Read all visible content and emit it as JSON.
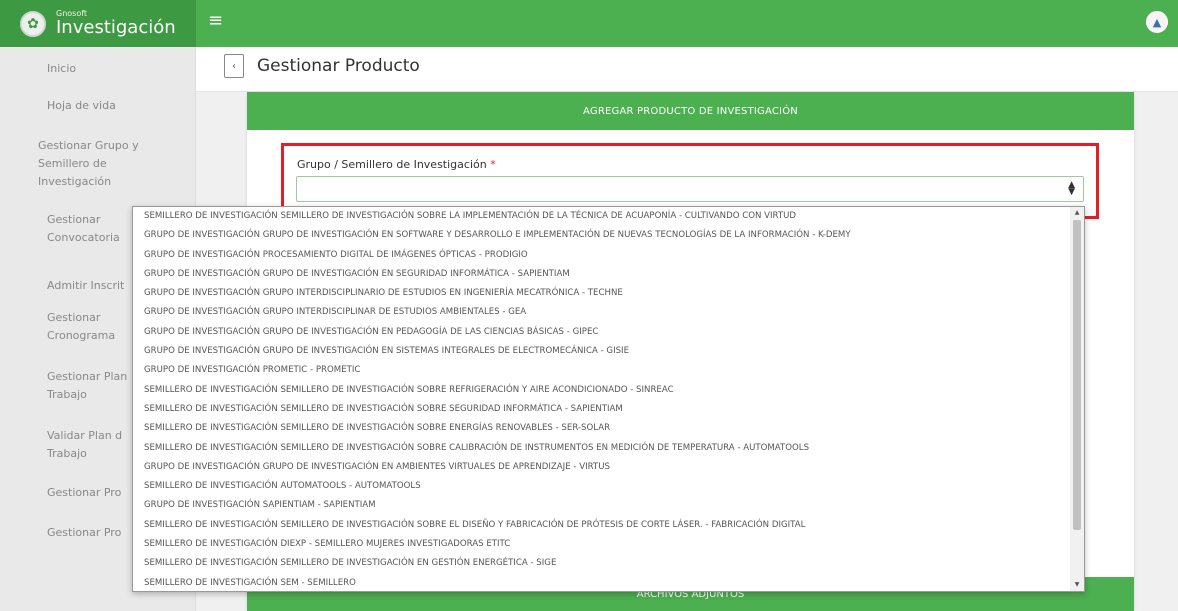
{
  "brand": {
    "small": "Gnosoft",
    "name": "Investigación"
  },
  "icons": {
    "hamburger": "≡",
    "avatar": "user-avatar-icon",
    "back": "‹",
    "select_arrow": "⇕"
  },
  "sidebar": {
    "items": [
      {
        "label": "Inicio"
      },
      {
        "label": "Hoja de vida"
      },
      {
        "label": "Gestionar Grupo y Semillero de Investigación"
      },
      {
        "label": "Gestionar Convocatoria"
      },
      {
        "label": "Admitir Inscrit"
      },
      {
        "label": "Gestionar Cronograma"
      },
      {
        "label": "Gestionar Plan Trabajo"
      },
      {
        "label": "Validar Plan d Trabajo"
      },
      {
        "label": "Gestionar Pro"
      },
      {
        "label": "Gestionar Pro"
      }
    ]
  },
  "page": {
    "title": "Gestionar Producto"
  },
  "card": {
    "header": "AGREGAR PRODUCTO DE INVESTIGACIÓN",
    "field_label": "Grupo / Semillero de Investigación",
    "required_mark": "*",
    "selected_value": ""
  },
  "bottom_bar": {
    "label": "ARCHIVOS ADJUNTOS"
  },
  "dropdown": {
    "options": [
      "SEMILLERO DE INVESTIGACIÓN SEMILLERO DE INVESTIGACIÓN SOBRE LA IMPLEMENTACIÓN DE LA TÉCNICA DE ACUAPONÍA - CULTIVANDO CON VIRTUD",
      "GRUPO DE INVESTIGACIÓN GRUPO DE INVESTIGACIÓN EN SOFTWARE Y DESARROLLO E IMPLEMENTACIÓN DE NUEVAS TECNOLOGÍAS DE LA INFORMACIÓN - K-DEMY",
      "GRUPO DE INVESTIGACIÓN PROCESAMIENTO DIGITAL DE IMÁGENES ÓPTICAS - PRODIGIO",
      "GRUPO DE INVESTIGACIÓN GRUPO DE INVESTIGACIÓN EN SEGURIDAD INFORMÁTICA - SAPIENTIAM",
      "GRUPO DE INVESTIGACIÓN GRUPO INTERDISCIPLINARIO DE ESTUDIOS EN INGENIERÍA MECATRÓNICA - TECHNE",
      "GRUPO DE INVESTIGACIÓN GRUPO INTERDISCIPLINAR DE ESTUDIOS AMBIENTALES - GEA",
      "GRUPO DE INVESTIGACIÓN GRUPO DE INVESTIGACIÓN EN PEDAGOGÍA DE LAS CIENCIAS BÁSICAS - GIPEC",
      "GRUPO DE INVESTIGACIÓN GRUPO DE INVESTIGACIÓN EN SISTEMAS INTEGRALES DE ELECTROMECÁNICA - GISIE",
      "GRUPO DE INVESTIGACIÓN PROMETIC - PROMETIC",
      "SEMILLERO DE INVESTIGACIÓN SEMILLERO DE INVESTIGACIÓN SOBRE REFRIGERACIÓN Y AIRE ACONDICIONADO - SINREAC",
      "SEMILLERO DE INVESTIGACIÓN SEMILLERO DE INVESTIGACIÓN SOBRE SEGURIDAD INFORMÁTICA - SAPIENTIAM",
      "SEMILLERO DE INVESTIGACIÓN SEMILLERO DE INVESTIGACIÓN SOBRE ENERGÍAS RENOVABLES - SER-SOLAR",
      "SEMILLERO DE INVESTIGACIÓN SEMILLERO DE INVESTIGACIÓN SOBRE CALIBRACIÓN DE INSTRUMENTOS EN MEDICIÓN DE TEMPERATURA - AUTOMATOOLS",
      "GRUPO DE INVESTIGACIÓN GRUPO DE INVESTIGACIÓN EN AMBIENTES VIRTUALES DE APRENDIZAJE - VIRTUS",
      "SEMILLERO DE INVESTIGACIÓN AUTOMATOOLS - AUTOMATOOLS",
      "GRUPO DE INVESTIGACIÓN SAPIENTIAM - SAPIENTIAM",
      "SEMILLERO DE INVESTIGACIÓN SEMILLERO DE INVESTIGACIÓN SOBRE EL DISEÑO Y FABRICACIÓN DE PRÓTESIS DE CORTE LÁSER. - FABRICACIÓN DIGITAL",
      "SEMILLERO DE INVESTIGACIÓN DIEXP - SEMILLERO MUJERES INVESTIGADORAS ETITC",
      "SEMILLERO DE INVESTIGACIÓN SEMILLERO DE INVESTIGACIÓN EN GESTIÓN ENERGÉTICA - SIGE",
      "SEMILLERO DE INVESTIGACIÓN SEM - SEMILLERO"
    ]
  }
}
